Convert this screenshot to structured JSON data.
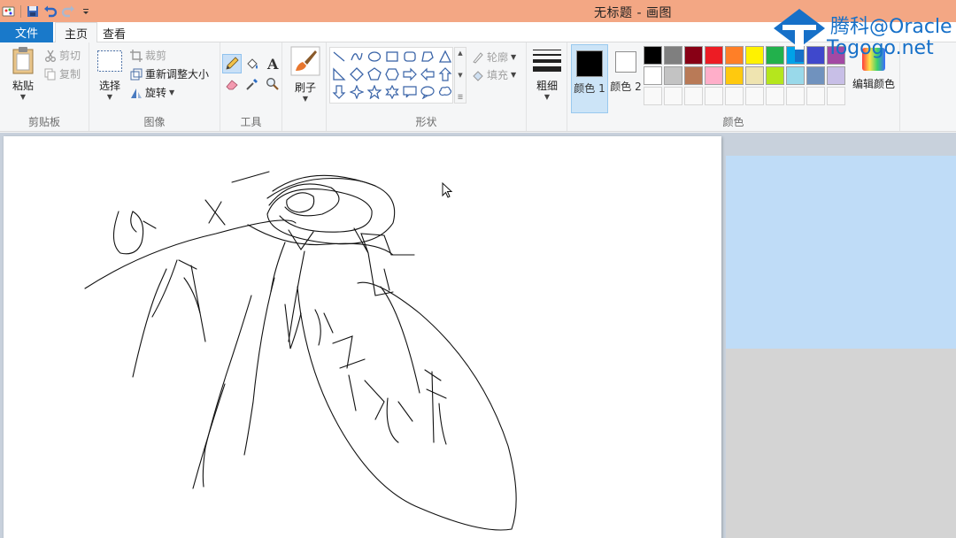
{
  "window": {
    "title": "无标题 - 画图"
  },
  "tabs": {
    "file": "文件",
    "home": "主页",
    "view": "查看"
  },
  "clipboard": {
    "paste": "粘贴",
    "cut": "剪切",
    "copy": "复制",
    "label": "剪贴板"
  },
  "image": {
    "select": "选择",
    "crop": "裁剪",
    "resize": "重新调整大小",
    "rotate": "旋转",
    "label": "图像"
  },
  "tools": {
    "label": "工具",
    "active_tool": "pencil-icon"
  },
  "brushes": {
    "label": "刷子"
  },
  "shapes": {
    "outline": "轮廓",
    "fill": "填充",
    "label": "形状"
  },
  "size": {
    "label": "粗细"
  },
  "colors": {
    "color1_label": "颜色 1",
    "color2_label": "颜色 2",
    "color1": "#000000",
    "color2": "#ffffff",
    "edit_label": "编辑颜色",
    "label": "颜色",
    "palette": [
      "#000000",
      "#7f7f7f",
      "#880015",
      "#ed1c24",
      "#ff7f27",
      "#fff200",
      "#22b14c",
      "#00a2e8",
      "#3f48cc",
      "#a349a4",
      "#ffffff",
      "#c3c3c3",
      "#b97a57",
      "#ffaec9",
      "#ffc90e",
      "#efe4b0",
      "#b5e61d",
      "#99d9ea",
      "#7092be",
      "#c8bfe7"
    ],
    "accent": "#1979ca"
  },
  "watermark": {
    "line1": "腾科@Oracle",
    "line2": "Togogo.net"
  }
}
